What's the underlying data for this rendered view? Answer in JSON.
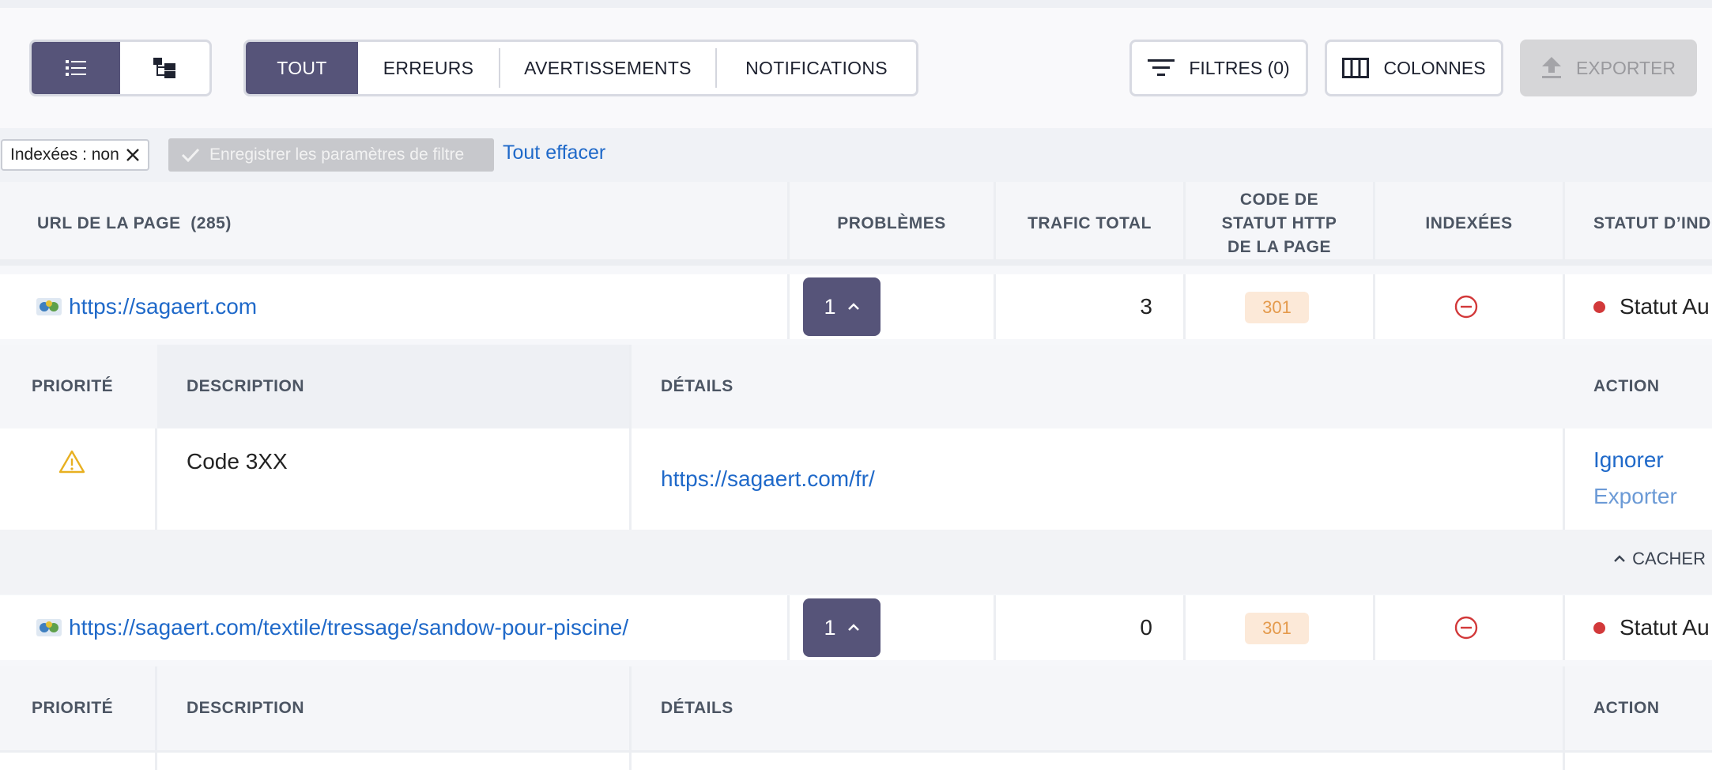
{
  "view_toggle": {
    "list_icon": "list-icon",
    "tree_icon": "tree-icon"
  },
  "tabs": [
    {
      "label": "TOUT",
      "active": true
    },
    {
      "label": "ERREURS",
      "active": false
    },
    {
      "label": "AVERTISSEMENTS",
      "active": false
    },
    {
      "label": "NOTIFICATIONS",
      "active": false
    }
  ],
  "actions": {
    "filters": "FILTRES (0)",
    "columns": "COLONNES",
    "export": "EXPORTER"
  },
  "filters_bar": {
    "chip_label": "Indexées : ",
    "chip_value": "non",
    "save_label": "Enregistrer les paramètres de filtre",
    "clear_label": "Tout effacer"
  },
  "table": {
    "headers": {
      "url": "URL DE LA PAGE",
      "count": "(285)",
      "problems": "PROBLÈMES",
      "traffic": "TRAFIC TOTAL",
      "status_code_1": "CODE DE",
      "status_code_2": "STATUT HTTP",
      "status_code_3": "DE LA PAGE",
      "indexed": "INDEXÉES",
      "index_status": "STATUT D’IND"
    },
    "rows": [
      {
        "url": "https://sagaert.com",
        "problems": "1",
        "traffic": "3",
        "code": "301",
        "index_status": "Statut Au"
      },
      {
        "url": "https://sagaert.com/textile/tressage/sandow-pour-piscine/",
        "problems": "1",
        "traffic": "0",
        "code": "301",
        "index_status": "Statut Au"
      }
    ],
    "sub_headers": {
      "priority": "PRIORITÉ",
      "description": "DESCRIPTION",
      "details": "DÉTAILS",
      "action": "ACTION"
    },
    "issue": {
      "description": "Code 3XX",
      "details": "https://sagaert.com/fr/",
      "ignore": "Ignorer",
      "export": "Exporter"
    },
    "hide_label": "CACHER"
  },
  "colors": {
    "accent": "#565479",
    "link": "#1f69c9",
    "badge_bg": "#fce9d8",
    "badge_text": "#e49a4c",
    "error": "#d2393a",
    "warning": "#e8b021"
  }
}
